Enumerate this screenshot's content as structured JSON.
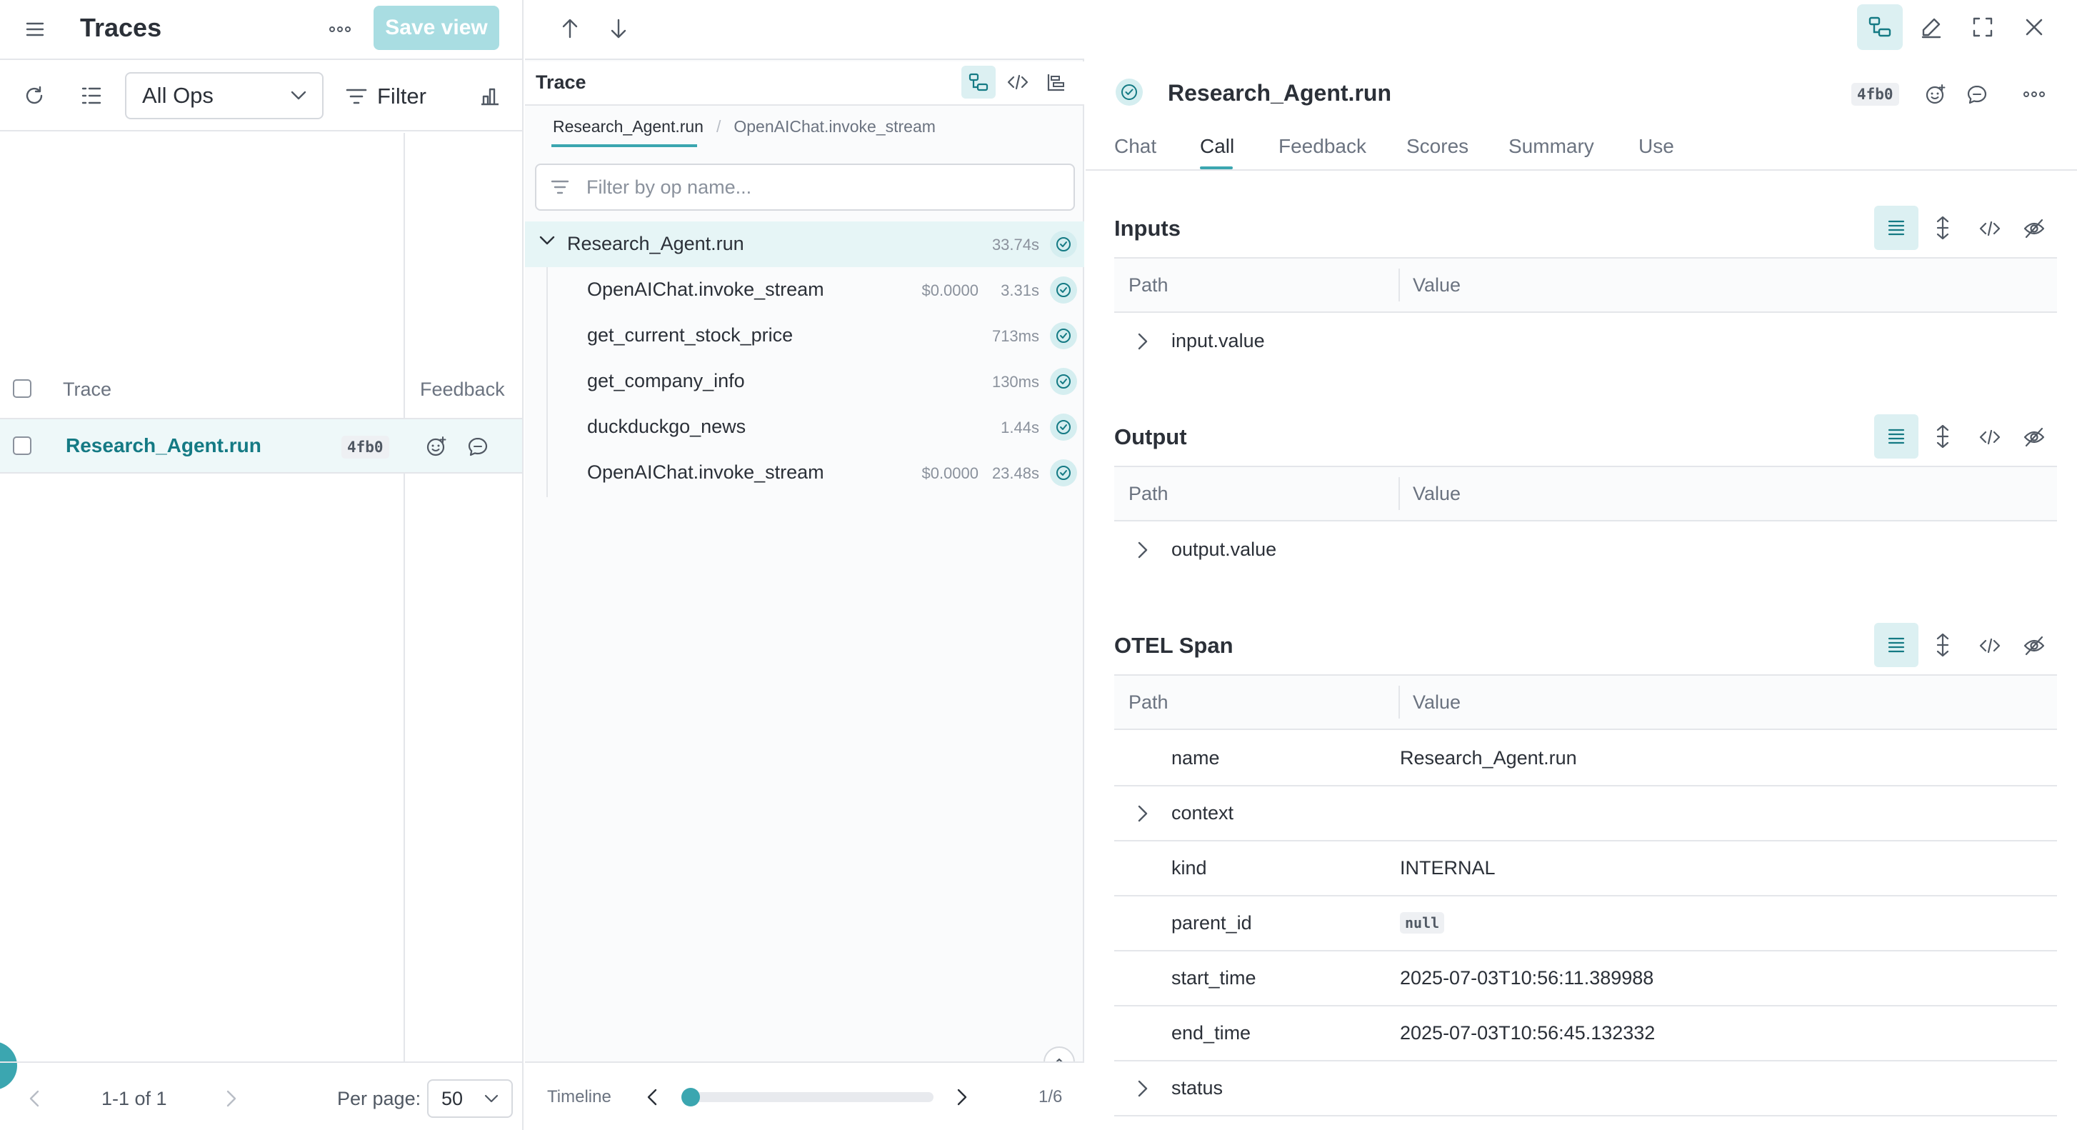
{
  "header": {
    "title": "Traces",
    "save_view": "Save view"
  },
  "toolbar": {
    "ops_select": "All Ops",
    "filter": "Filter"
  },
  "table": {
    "col_trace": "Trace",
    "col_feedback": "Feedback",
    "rows": [
      {
        "name": "Research_Agent.run",
        "id": "4fb0"
      }
    ]
  },
  "pager": {
    "range": "1-1 of 1",
    "per_page_label": "Per page:",
    "per_page_value": "50"
  },
  "trace_panel": {
    "label": "Trace",
    "breadcrumb": [
      "Research_Agent.run",
      "OpenAIChat.invoke_stream"
    ],
    "filter_placeholder": "Filter by op name...",
    "tree": [
      {
        "name": "Research_Agent.run",
        "cost": "",
        "duration": "33.74s"
      },
      {
        "name": "OpenAIChat.invoke_stream",
        "cost": "$0.0000",
        "duration": "3.31s"
      },
      {
        "name": "get_current_stock_price",
        "cost": "",
        "duration": "713ms"
      },
      {
        "name": "get_company_info",
        "cost": "",
        "duration": "130ms"
      },
      {
        "name": "duckduckgo_news",
        "cost": "",
        "duration": "1.44s"
      },
      {
        "name": "OpenAIChat.invoke_stream",
        "cost": "$0.0000",
        "duration": "23.48s"
      }
    ],
    "timeline_label": "Timeline",
    "timeline_position": "1/6",
    "timeline_progress": 0
  },
  "call": {
    "title": "Research_Agent.run",
    "id": "4fb0",
    "tabs": [
      "Chat",
      "Call",
      "Feedback",
      "Scores",
      "Summary",
      "Use"
    ],
    "active_tab": "Call"
  },
  "sections": {
    "inputs": {
      "title": "Inputs",
      "path": "Path",
      "value": "Value",
      "row": "input.value"
    },
    "output": {
      "title": "Output",
      "path": "Path",
      "value": "Value",
      "row": "output.value"
    },
    "otel": {
      "title": "OTEL Span",
      "path": "Path",
      "value": "Value",
      "rows": [
        {
          "key": "name",
          "value": "Research_Agent.run"
        },
        {
          "key": "context",
          "value": ""
        },
        {
          "key": "kind",
          "value": "INTERNAL"
        },
        {
          "key": "parent_id",
          "value": "null"
        },
        {
          "key": "start_time",
          "value": "2025-07-03T10:56:11.389988"
        },
        {
          "key": "end_time",
          "value": "2025-07-03T10:56:45.132332"
        },
        {
          "key": "status",
          "value": ""
        }
      ]
    }
  },
  "colors": {
    "accent": "#3ba6b0",
    "accent_light": "#dcf0f2",
    "link": "#147a84"
  }
}
